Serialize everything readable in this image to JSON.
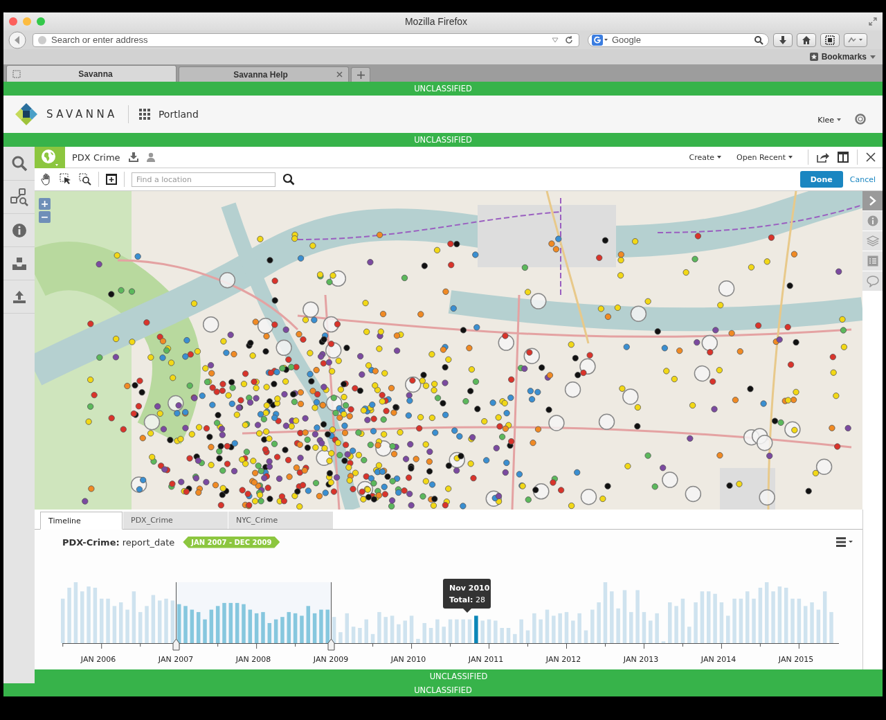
{
  "browser": {
    "title": "Mozilla Firefox",
    "address": {
      "placeholder": "Search or enter address"
    },
    "search": {
      "placeholder": "Google"
    },
    "bookmarks": "Bookmarks",
    "tabs": [
      {
        "label": "Savanna",
        "selected": true
      },
      {
        "label": "Savanna Help",
        "selected": false
      }
    ]
  },
  "banners": [
    "UNCLASSIFIED",
    "UNCLASSIFIED",
    "UNCLASSIFIED",
    "UNCLASSIFIED"
  ],
  "header": {
    "brand": "SAVANNA",
    "workspace": "Portland",
    "user": "Klee"
  },
  "panel": {
    "title": "PDX Crime",
    "menus": [
      "Create",
      "Open Recent"
    ],
    "location": {
      "placeholder": "Find a location"
    },
    "done": "Done",
    "cancel": "Cancel"
  },
  "map": {
    "zoom_in": "+",
    "zoom_out": "−"
  },
  "bottom_tabs": [
    {
      "label": "Timeline",
      "selected": true
    },
    {
      "label": "PDX_Crime",
      "selected": false
    },
    {
      "label": "NYC_Crime",
      "selected": false
    }
  ],
  "timeline": {
    "dataset": "PDX-Crime:",
    "field": "report_date",
    "range": "JAN 2007 - DEC 2009",
    "tooltip": {
      "title": "Nov 2010",
      "total_label": "Total:",
      "total": "28"
    },
    "axis_labels": [
      "JAN 2006",
      "JAN 2007",
      "JAN 2008",
      "JAN 2009",
      "JAN 2010",
      "JAN 2011",
      "JAN 2012",
      "JAN 2013",
      "JAN 2014",
      "JAN 2015"
    ]
  }
}
